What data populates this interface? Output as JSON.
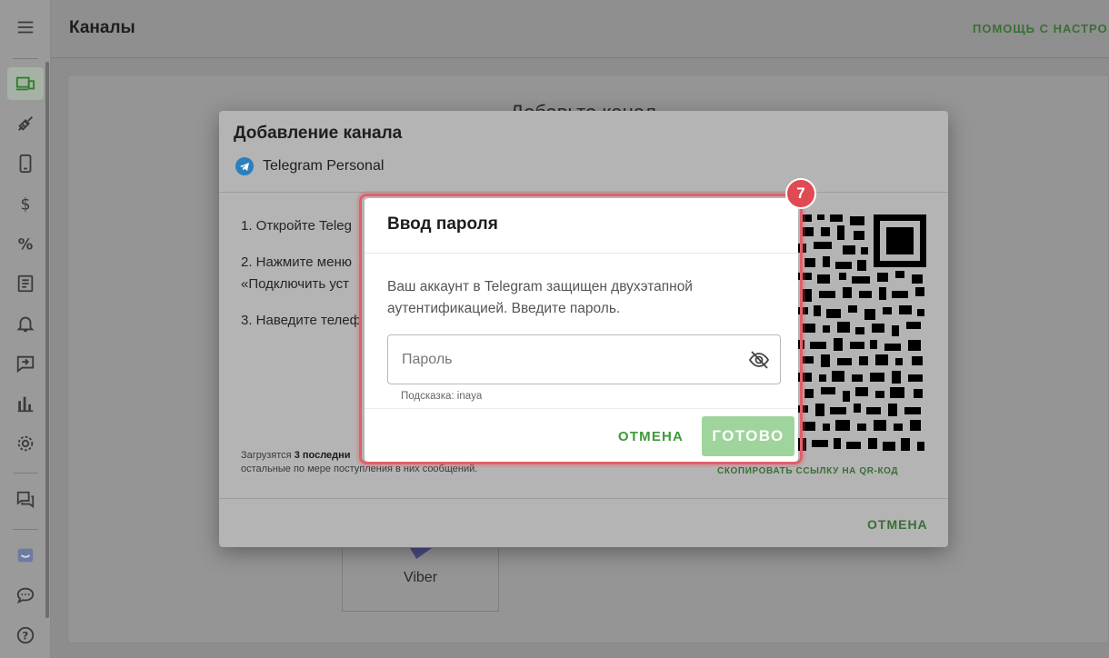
{
  "header": {
    "title": "Каналы",
    "help_label": "ПОМОЩЬ С НАСТРО"
  },
  "sidebar": {
    "items": [
      {
        "icon": "menu-icon"
      },
      {
        "icon": "channels-icon",
        "active": true
      },
      {
        "icon": "integrations-icon"
      },
      {
        "icon": "phone-icon"
      },
      {
        "icon": "billing-icon"
      },
      {
        "icon": "percent-icon"
      },
      {
        "icon": "document-icon"
      },
      {
        "icon": "bell-icon"
      },
      {
        "icon": "message-forward-icon"
      },
      {
        "icon": "stats-icon"
      },
      {
        "icon": "gear-icon"
      },
      {
        "icon": "chats-icon"
      },
      {
        "icon": "inbox-icon"
      },
      {
        "icon": "chat-bubble-icon"
      },
      {
        "icon": "help-icon"
      }
    ],
    "accent_color": "#3a8a36"
  },
  "content": {
    "heading": "Добавьте канал",
    "viber_label": "Viber"
  },
  "dialog": {
    "title": "Добавление канала",
    "subtitle": "Telegram Personal",
    "steps": [
      "1. Откройте Teleg",
      "2. Нажмите меню",
      "«Подключить уст",
      "3. Наведите телеф"
    ],
    "note_prefix": "Загрузятся ",
    "note_bold": "3 последни",
    "note_line2": "остальные по мере поступления в них сообщений.",
    "copy_link_label": "СКОПИРОВАТЬ ССЫЛКУ НА QR-КОД",
    "cancel_label": "ОТМЕНА"
  },
  "password_modal": {
    "title": "Ввод пароля",
    "text": "Ваш аккаунт в Telegram защищен двухэтапной аутентификацией. Введите пароль.",
    "password_placeholder": "Пароль",
    "password_value": "",
    "hint": "Подсказка: inaya",
    "cancel_label": "ОТМЕНА",
    "done_label": "ГОТОВО",
    "highlight_color": "#e0606a"
  },
  "step_badge": "7",
  "colors": {
    "green": "#3d9a3a",
    "done_disabled": "#9fd49d",
    "telegram": "#2b7fbd",
    "badge": "#e04a52"
  }
}
